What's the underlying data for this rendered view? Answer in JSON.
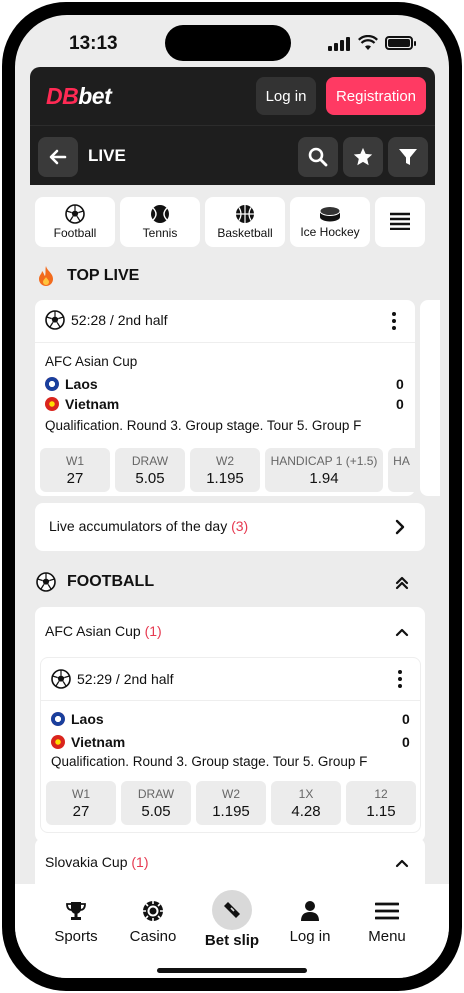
{
  "status": {
    "time": "13:13"
  },
  "header": {
    "logo_db": "DB",
    "logo_bet": "bet",
    "login_label": "Log in",
    "register_label": "Registration",
    "accent": "#ff3a63"
  },
  "subheader": {
    "title": "LIVE"
  },
  "sports": [
    {
      "label": "Football",
      "icon": "soccer-ball-icon"
    },
    {
      "label": "Tennis",
      "icon": "tennis-ball-icon"
    },
    {
      "label": "Basketball",
      "icon": "basketball-icon"
    },
    {
      "label": "Ice Hockey",
      "icon": "hockey-puck-icon"
    }
  ],
  "top_live": {
    "title": "TOP LIVE",
    "match": {
      "time": "52:28 / 2nd half",
      "league": "AFC Asian Cup",
      "team1": "Laos",
      "team2": "Vietnam",
      "score1": "0",
      "score2": "0",
      "info": "Qualification. Round 3. Group stage. Tour 5. Group F",
      "odds": [
        {
          "label": "W1",
          "value": "27"
        },
        {
          "label": "DRAW",
          "value": "5.05"
        },
        {
          "label": "W2",
          "value": "1.195"
        },
        {
          "label": "HANDICAP 1 (+1.5)",
          "value": "1.94"
        },
        {
          "label": "HA",
          "value": ""
        }
      ]
    },
    "accumulators_label": "Live accumulators of the day",
    "accumulators_count": "(3)"
  },
  "football": {
    "title": "FOOTBALL",
    "league1": {
      "name": "AFC Asian Cup",
      "count": "(1)"
    },
    "match": {
      "time": "52:29 / 2nd half",
      "team1": "Laos",
      "team2": "Vietnam",
      "score1": "0",
      "score2": "0",
      "info": "Qualification. Round 3. Group stage. Tour 5. Group F",
      "odds": [
        {
          "label": "W1",
          "value": "27"
        },
        {
          "label": "DRAW",
          "value": "5.05"
        },
        {
          "label": "W2",
          "value": "1.195"
        },
        {
          "label": "1X",
          "value": "4.28"
        },
        {
          "label": "12",
          "value": "1.15"
        }
      ]
    },
    "league2": {
      "name": "Slovakia Cup",
      "count": "(1)"
    }
  },
  "bottom_nav": [
    {
      "label": "Sports",
      "icon": "trophy-icon"
    },
    {
      "label": "Casino",
      "icon": "casino-chip-icon"
    },
    {
      "label": "Bet slip",
      "icon": "ticket-icon"
    },
    {
      "label": "Log in",
      "icon": "user-icon"
    },
    {
      "label": "Menu",
      "icon": "hamburger-icon"
    }
  ]
}
